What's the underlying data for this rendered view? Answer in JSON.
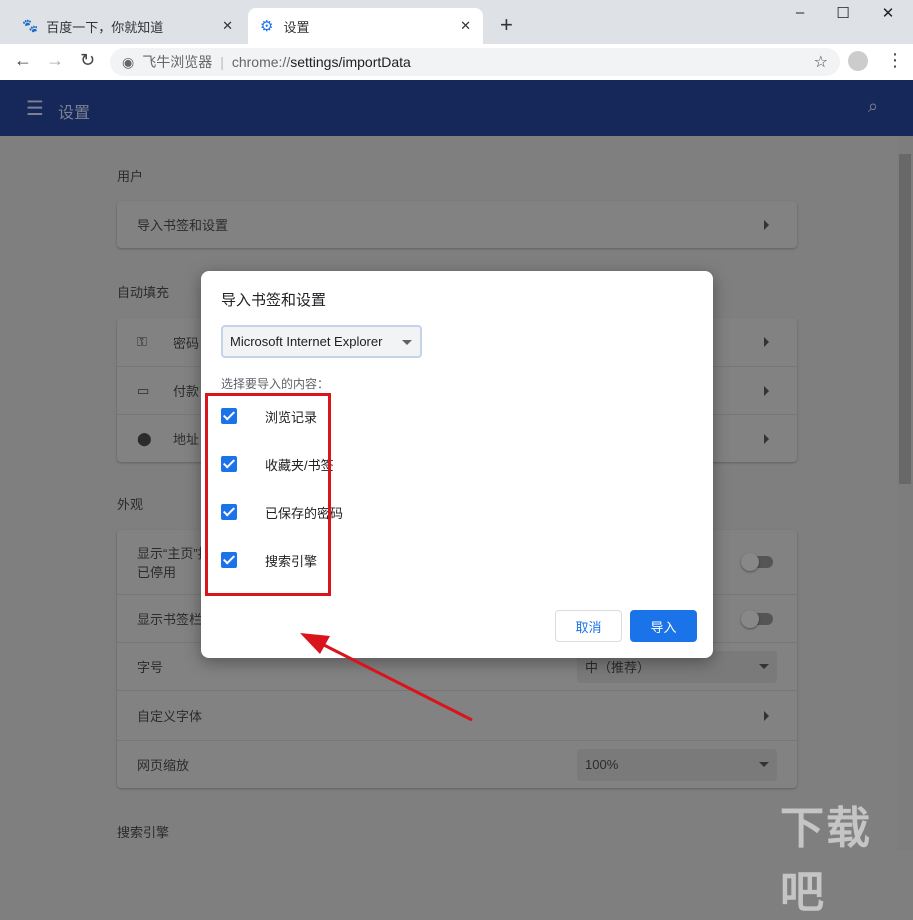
{
  "tabs": [
    {
      "title": "百度一下，你就知道",
      "icon": "baidu-paw-icon"
    },
    {
      "title": "设置",
      "icon": "gear-icon"
    }
  ],
  "window": {
    "minimize": "–",
    "maximize": "☐",
    "close": "✕",
    "new_tab": "+",
    "tab_close": "✕"
  },
  "toolbar": {
    "browser_name": "飞牛浏览器",
    "url_prefix": "chrome://",
    "url_path": "settings/importData"
  },
  "header": {
    "title": "设置"
  },
  "settings": {
    "user": {
      "title": "用户",
      "rows": [
        {
          "label": "导入书签和设置"
        }
      ]
    },
    "autofill": {
      "title": "自动填充",
      "rows": [
        {
          "label": "密码",
          "icon": "key-icon"
        },
        {
          "label": "付款",
          "icon": "credit-card-icon"
        },
        {
          "label": "地址",
          "icon": "location-pin-icon"
        }
      ]
    },
    "appearance": {
      "title": "外观",
      "home_label": "显示“主页”按钮",
      "home_sub": "已停用",
      "bookmarks_bar": "显示书签栏",
      "font_size": "字号",
      "font_size_value": "中（推荐）",
      "custom_fonts": "自定义字体",
      "zoom": "网页缩放",
      "zoom_value": "100%"
    },
    "search": {
      "title": "搜索引擎"
    }
  },
  "dialog": {
    "title": "导入书签和设置",
    "browser_select": "Microsoft Internet Explorer",
    "choose_label": "选择要导入的内容：",
    "options": [
      {
        "label": "浏览记录",
        "checked": true
      },
      {
        "label": "收藏夹/书签",
        "checked": true
      },
      {
        "label": "已保存的密码",
        "checked": true
      },
      {
        "label": "搜索引擎",
        "checked": true
      }
    ],
    "cancel": "取消",
    "import": "导入"
  },
  "colors": {
    "accent": "#1a73e8",
    "annotation": "#d9141b",
    "header": "#16275a"
  },
  "watermark": "下载吧"
}
